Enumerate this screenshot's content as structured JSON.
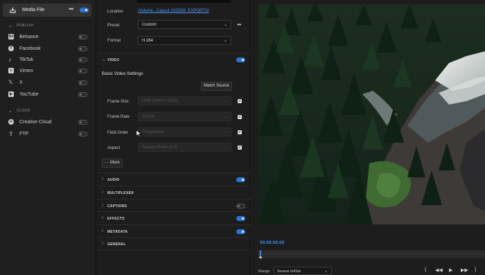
{
  "sidebar": {
    "media_file": {
      "label": "Media File",
      "more": "•••"
    },
    "publish_header": "PUBLISH",
    "publish_items": [
      {
        "label": "Behance",
        "icon": "Bē"
      },
      {
        "label": "Facebook",
        "icon": "f"
      },
      {
        "label": "TikTok",
        "icon": "♪"
      },
      {
        "label": "Vimeo",
        "icon": "v"
      },
      {
        "label": "X",
        "icon": "𝕏"
      },
      {
        "label": "YouTube",
        "icon": "▶"
      }
    ],
    "cloud_header": "CLOUD",
    "cloud_items": [
      {
        "label": "Creative Cloud",
        "icon": "∞"
      },
      {
        "label": "FTP",
        "icon": "⇪"
      }
    ]
  },
  "settings": {
    "location_label": "Location",
    "location_value": "/Volume...Capcut 2025/08_EXPORTS/",
    "preset_label": "Preset",
    "preset_value": "Custom",
    "more": "•••",
    "format_label": "Format",
    "format_value": "H.264",
    "video_section": "VIDEO",
    "basic_video_settings": "Basic Video Settings",
    "match_source": "Match Source",
    "frame_size_label": "Frame Size",
    "frame_size_value": "UHD (3840 x 2160)",
    "frame_rate_label": "Frame Rate",
    "frame_rate_value": "23.976",
    "field_order_label": "Field Order",
    "field_order_value": "Progressive",
    "aspect_label": "Aspect",
    "aspect_value": "Square Pixels (1.0)",
    "more_button": "More",
    "sections": [
      {
        "label": "AUDIO",
        "enabled": true
      },
      {
        "label": "MULTIPLEXER"
      },
      {
        "label": "CAPTIONS",
        "enabled": false
      },
      {
        "label": "EFFECTS",
        "enabled": true
      },
      {
        "label": "METADATA",
        "enabled": true
      },
      {
        "label": "GENERAL"
      }
    ]
  },
  "preview": {
    "timecode": "00:00:00:00",
    "range_label": "Range",
    "range_value": "Source In/Out"
  },
  "colors": {
    "accent": "#2b74d8",
    "link": "#4c9dff",
    "panel": "#1d1d1d"
  }
}
